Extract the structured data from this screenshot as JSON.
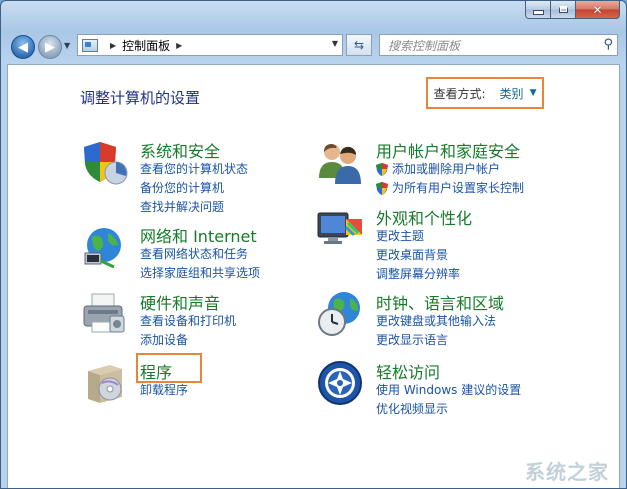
{
  "window": {
    "caption_buttons": {
      "minimize": "",
      "maximize": "",
      "close": "✕"
    }
  },
  "nav": {
    "back_glyph": "◀",
    "forward_glyph": "▶",
    "address": "控制面板",
    "refresh_glyph": "⇆",
    "search_placeholder": "搜索控制面板",
    "search_glyph": "⚲"
  },
  "header": {
    "title": "调整计算机的设置",
    "view_mode_label": "查看方式:",
    "view_mode_value": "类别",
    "view_mode_arrow": "▼"
  },
  "categories": [
    {
      "title": "系统和安全",
      "links": [
        "查看您的计算机状态",
        "备份您的计算机",
        "查找并解决问题"
      ],
      "icon": "shield-chart-icon"
    },
    {
      "title": "网络和 Internet",
      "links": [
        "查看网络状态和任务",
        "选择家庭组和共享选项"
      ],
      "icon": "network-globe-icon"
    },
    {
      "title": "硬件和声音",
      "links": [
        "查看设备和打印机",
        "添加设备"
      ],
      "icon": "printer-icon"
    },
    {
      "title": "程序",
      "links": [
        "卸载程序"
      ],
      "icon": "programs-box-icon"
    },
    {
      "title": "用户帐户和家庭安全",
      "links": [
        "添加或删除用户帐户",
        "为所有用户设置家长控制"
      ],
      "icon": "users-icon"
    },
    {
      "title": "外观和个性化",
      "links": [
        "更改主题",
        "更改桌面背景",
        "调整屏幕分辨率"
      ],
      "icon": "monitor-palette-icon"
    },
    {
      "title": "时钟、语言和区域",
      "links": [
        "更改键盘或其他输入法",
        "更改显示语言"
      ],
      "icon": "clock-globe-icon"
    },
    {
      "title": "轻松访问",
      "links": [
        "使用 Windows 建议的设置",
        "优化视频显示"
      ],
      "icon": "ease-of-access-icon"
    }
  ],
  "watermark": "系统之家"
}
